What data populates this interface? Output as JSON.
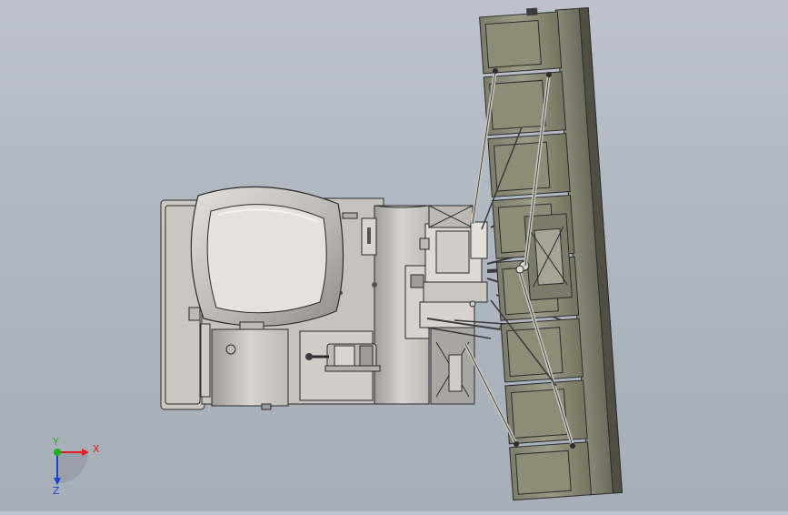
{
  "viewport": {
    "background_top": "#bcc3cc",
    "background_bottom": "#a6aeb8"
  },
  "model": {
    "body_color": "#cfcdc6",
    "shadow_color": "#8d8b86",
    "edge_color": "#2b2b2b",
    "panel_color": "#8f8f7a",
    "panel_dark": "#6e6e5e"
  },
  "triad": {
    "x_label": "X",
    "y_label": "Y",
    "z_label": "Z",
    "x_color": "#e02020",
    "y_color": "#20b020",
    "z_color": "#2040d0"
  }
}
